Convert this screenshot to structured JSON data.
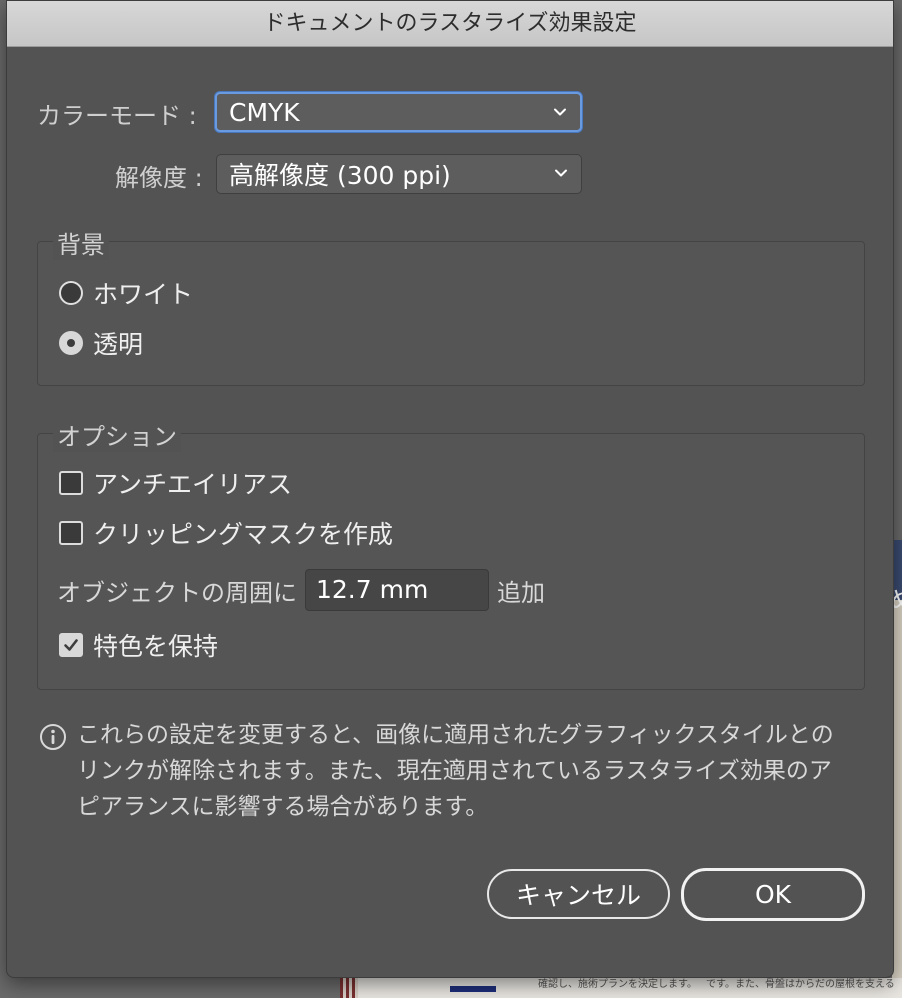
{
  "window": {
    "title": "ドキュメントのラスタライズ効果設定"
  },
  "color_mode": {
    "label": "カラーモード :",
    "value": "CMYK"
  },
  "resolution": {
    "label": "解像度 :",
    "value": "高解像度 (300 ppi)"
  },
  "background": {
    "title": "背景",
    "options": [
      {
        "label": "ホワイト",
        "selected": false
      },
      {
        "label": "透明",
        "selected": true
      }
    ]
  },
  "options": {
    "title": "オプション",
    "antialias": {
      "label": "アンチエイリアス",
      "checked": false
    },
    "clipping_mask": {
      "label": "クリッピングマスクを作成",
      "checked": false
    },
    "padding": {
      "prefix": "オブジェクトの周囲に",
      "value": "12.7 mm",
      "suffix": "追加"
    },
    "preserve_spot": {
      "label": "特色を保持",
      "checked": true
    }
  },
  "info": {
    "lines": [
      "これらの設定を変更すると、画像に適用されたグラフィックスタイルとの",
      "リンクが解除されます。また、現在適用されているラスタライズ効果のア",
      "ピアランスに影響する場合があります。"
    ]
  },
  "buttons": {
    "cancel": "キャンセル",
    "ok": "OK"
  },
  "background_document": {
    "right_glyph": "め",
    "bottom_text_1": "確認し、施術プランを決定します。",
    "bottom_text_2": "です。また、骨盤はからだの屋根を支える"
  },
  "colors": {
    "dialog_bg": "#535353",
    "focus_ring": "#6a9be0",
    "titlebar": "#d0d0d0"
  }
}
